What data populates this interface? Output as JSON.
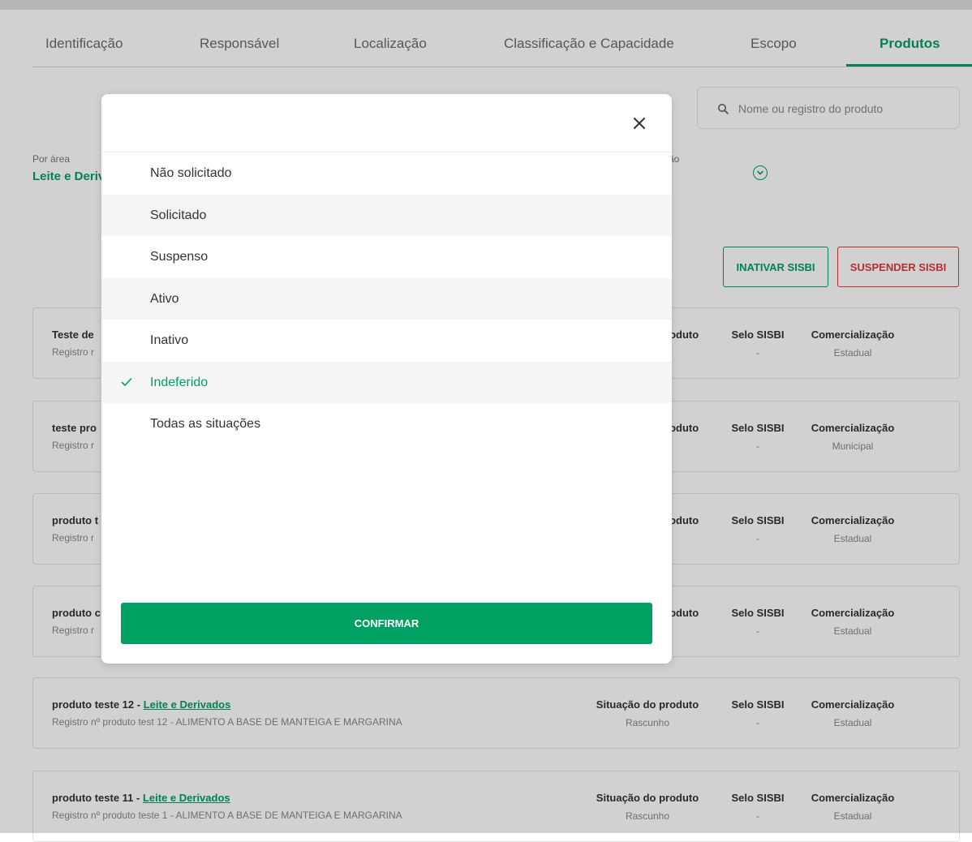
{
  "tabs": [
    {
      "label": "Identificação"
    },
    {
      "label": "Responsável"
    },
    {
      "label": "Localização"
    },
    {
      "label": "Classificação e Capacidade"
    },
    {
      "label": "Escopo"
    },
    {
      "label": "Produtos",
      "active": true
    }
  ],
  "search": {
    "placeholder": "Nome ou registro do produto"
  },
  "filters": {
    "area_label": "Por área",
    "area_value": "Leite e Derivados",
    "situacao_label_fragment": "ção"
  },
  "actions": {
    "inativar": "INATIVAR SISBI",
    "suspender": "SUSPENDER SISBI"
  },
  "columns": {
    "situacao": "Situação do produto",
    "selo": "Selo SISBI",
    "comercializacao": "Comercialização"
  },
  "products": [
    {
      "title_prefix": "Teste de",
      "area": "",
      "registro": "Registro r",
      "situacao": "",
      "selo": "-",
      "comercializacao": "Estadual"
    },
    {
      "title_prefix": "teste pro",
      "area": "",
      "registro": "Registro r",
      "situacao": "",
      "selo": "-",
      "comercializacao": "Municipal"
    },
    {
      "title_prefix": "produto t",
      "area": "",
      "registro": "Registro r",
      "situacao": "",
      "selo": "-",
      "comercializacao": "Estadual"
    },
    {
      "title_prefix": "produto c",
      "area": "",
      "registro": "Registro r",
      "situacao": "",
      "selo": "-",
      "comercializacao": "Estadual"
    },
    {
      "title_prefix": "produto teste 12 - ",
      "area": "Leite e Derivados",
      "registro": "Registro nº produto test 12 - ALIMENTO A BASE DE MANTEIGA E MARGARINA",
      "situacao": "Rascunho",
      "selo": "-",
      "comercializacao": "Estadual"
    },
    {
      "title_prefix": "produto teste 11 - ",
      "area": "Leite e Derivados",
      "registro": "Registro nº produto teste 1 - ALIMENTO A BASE DE MANTEIGA E MARGARINA",
      "situacao": "Rascunho",
      "selo": "-",
      "comercializacao": "Estadual"
    }
  ],
  "modal": {
    "options": [
      {
        "label": "Não solicitado",
        "selected": false
      },
      {
        "label": "Solicitado",
        "selected": false
      },
      {
        "label": "Suspenso",
        "selected": false
      },
      {
        "label": "Ativo",
        "selected": false
      },
      {
        "label": "Inativo",
        "selected": false
      },
      {
        "label": "Indeferido",
        "selected": true
      },
      {
        "label": "Todas as situações",
        "selected": false
      }
    ],
    "confirm_label": "CONFIRMAR"
  },
  "colors": {
    "accent": "#00a062",
    "danger": "#e0393e"
  },
  "icons": {
    "search": "search-icon",
    "close": "close-icon",
    "check": "check-icon",
    "chevron": "chevron-down-icon"
  }
}
